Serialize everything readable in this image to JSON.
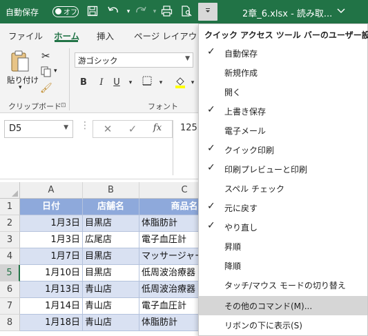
{
  "titlebar": {
    "autosave_label": "自動保存",
    "autosave_toggle": "オフ",
    "document_title": "2章_6.xlsx  -  読み取...",
    "qat_icons": [
      "save-icon",
      "undo-icon",
      "redo-icon",
      "quick-print-icon",
      "print-preview-icon"
    ]
  },
  "ribbon": {
    "tabs": [
      "ファイル",
      "ホーム",
      "挿入",
      "ページ レイアウト"
    ],
    "active_tab": "ホーム",
    "clipboard": {
      "paste_label": "貼り付け",
      "group_label": "クリップボード"
    },
    "font": {
      "font_name": "游ゴシック",
      "group_label": "フォント",
      "bold": "B",
      "italic": "I",
      "underline": "U"
    }
  },
  "formula_bar": {
    "name_box": "D5",
    "fx": "fx",
    "value": "125"
  },
  "sheet": {
    "columns": [
      "A",
      "B",
      "C"
    ],
    "rows": [
      "1",
      "2",
      "3",
      "4",
      "5",
      "6",
      "7",
      "8"
    ],
    "selected_row": "5",
    "header": [
      "日付",
      "店舗名",
      "商品名"
    ],
    "data": [
      [
        "1月3日",
        "目黒店",
        "体脂肪計"
      ],
      [
        "1月3日",
        "広尾店",
        "電子血圧計"
      ],
      [
        "1月7日",
        "目黒店",
        "マッサージャー"
      ],
      [
        "1月10日",
        "目黒店",
        "低周波治療器"
      ],
      [
        "1月13日",
        "青山店",
        "低周波治療器"
      ],
      [
        "1月14日",
        "青山店",
        "電子血圧計"
      ],
      [
        "1月18日",
        "青山店",
        "体脂肪計"
      ]
    ],
    "colors": {
      "header": "#8ea9db",
      "band": "#d9e1f2",
      "accent": "#217346"
    }
  },
  "menu": {
    "title": "クイック アクセス ツール バーのユーザー設定",
    "items": [
      {
        "label": "自動保存",
        "checked": "✓"
      },
      {
        "label": "新規作成",
        "checked": ""
      },
      {
        "label": "開く",
        "checked": ""
      },
      {
        "label": "上書き保存",
        "checked": "✓"
      },
      {
        "label": "電子メール",
        "checked": ""
      },
      {
        "label": "クイック印刷",
        "checked": "✓"
      },
      {
        "label": "印刷プレビューと印刷",
        "checked": "✓"
      },
      {
        "label": "スペル チェック",
        "checked": ""
      },
      {
        "label": "元に戻す",
        "checked": "✓"
      },
      {
        "label": "やり直し",
        "checked": "✓"
      },
      {
        "label": "昇順",
        "checked": ""
      },
      {
        "label": "降順",
        "checked": ""
      },
      {
        "label": "タッチ/マウス モードの切り替え",
        "checked": ""
      },
      {
        "label": "その他のコマンド(M)...",
        "checked": ""
      },
      {
        "label": "リボンの下に表示(S)",
        "checked": ""
      }
    ],
    "highlighted_item": "その他のコマンド(M)..."
  }
}
